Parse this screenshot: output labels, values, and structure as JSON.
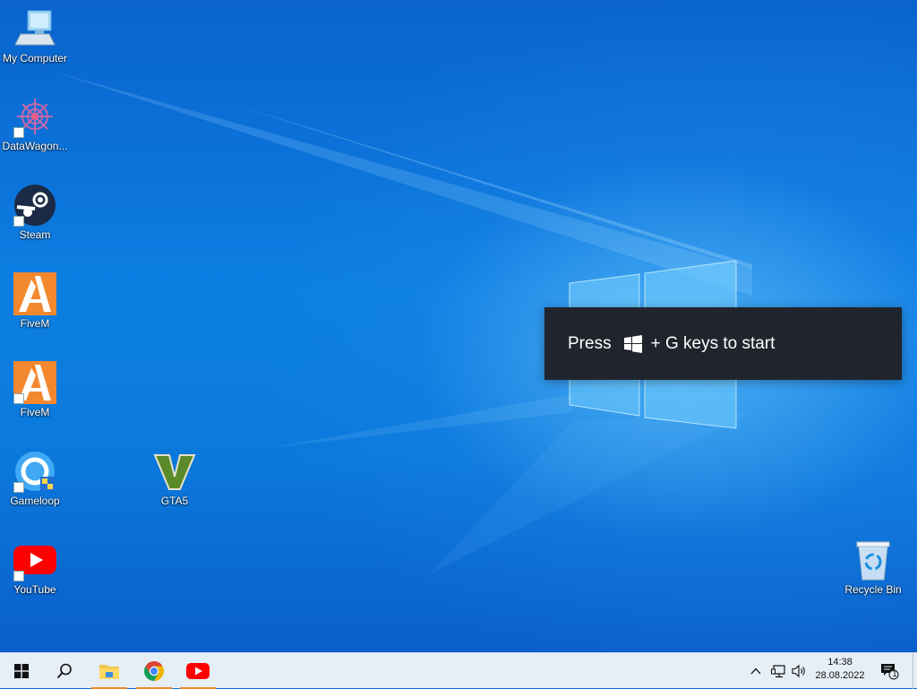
{
  "desktop": {
    "icons": [
      {
        "label": "My Computer"
      },
      {
        "label": "DataWagon..."
      },
      {
        "label": "Steam"
      },
      {
        "label": "FiveM"
      },
      {
        "label": "FiveM"
      },
      {
        "label": "Gameloop"
      },
      {
        "label": "GTA5"
      },
      {
        "label": "YouTube"
      },
      {
        "label": "Recycle Bin"
      }
    ]
  },
  "toast": {
    "press": "Press",
    "rest": "+ G keys to start"
  },
  "taskbar": {
    "clock_time": "14:38",
    "clock_date": "28.08.2022",
    "notification_count": "1",
    "pinned": [
      "file-explorer",
      "chrome",
      "youtube"
    ]
  },
  "colors": {
    "toast_bg": "#20252d",
    "taskbar_bg": "#e6eef6",
    "active_indicator": "#f08a24",
    "fivem_orange": "#f4882f",
    "youtube_red": "#ff0000"
  }
}
